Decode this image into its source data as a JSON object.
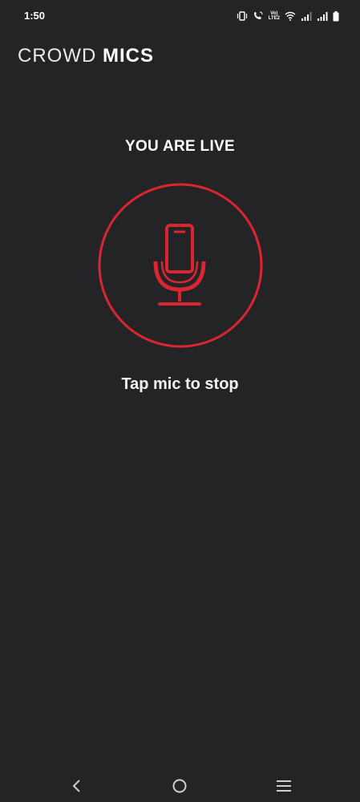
{
  "status_bar": {
    "time": "1:50",
    "volte_line1": "Vo)",
    "volte_line2": "LTE2",
    "icons": [
      "vibrate-icon",
      "wifi-calling-icon",
      "volte-icon",
      "wifi-icon",
      "signal-icon",
      "signal-icon",
      "battery-icon"
    ]
  },
  "header": {
    "title_light": "CROWD",
    "title_bold": "MICS"
  },
  "live": {
    "heading": "YOU ARE LIVE",
    "hint": "Tap mic to stop",
    "icon": "microphone-icon"
  },
  "nav_bar": {
    "icons": [
      "back-icon",
      "home-icon",
      "recents-icon"
    ]
  },
  "colors": {
    "background": "#242325",
    "accent": "#d92631",
    "text": "#ffffff"
  }
}
